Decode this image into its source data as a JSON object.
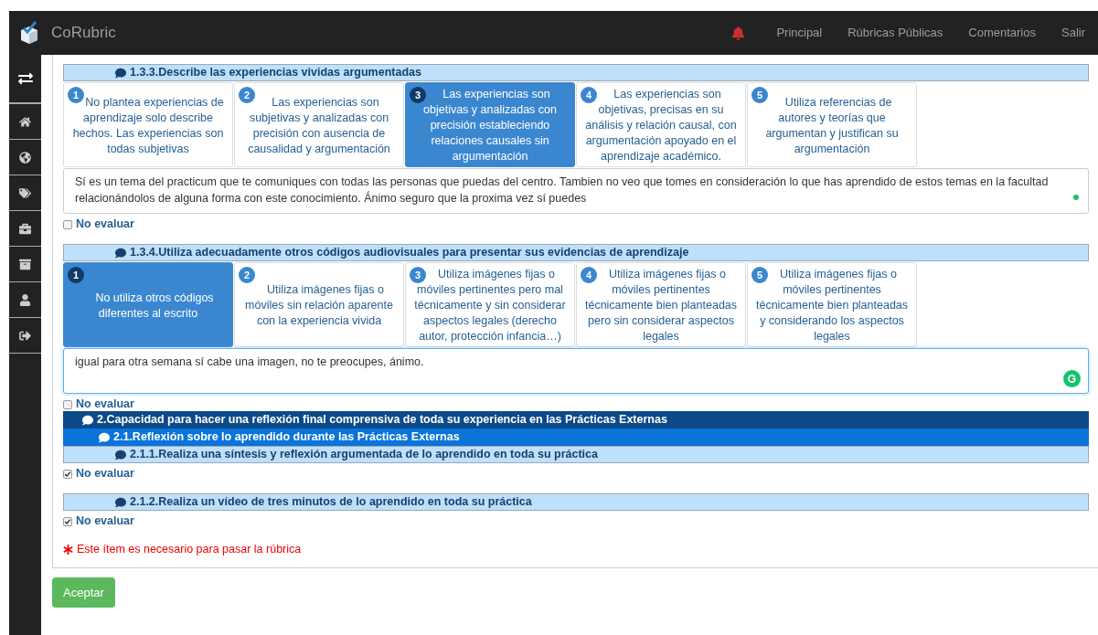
{
  "navbar": {
    "brand": "CoRubric",
    "links": [
      "Principal",
      "Rúbricas Públicas",
      "Comentarios",
      "Salir"
    ]
  },
  "sections": [
    {
      "kind": "indicator",
      "title": "1.3.3.Describe las experiencias vividas argumentadas",
      "options": [
        {
          "number": "1",
          "text": "No plantea experiencias de aprendizaje solo describe hechos. Las experiencias son todas subjetivas",
          "selected": false
        },
        {
          "number": "2",
          "text": "Las experiencias son subjetivas y analizadas con precisión con ausencia de causalidad y argumentación",
          "selected": false
        },
        {
          "number": "3",
          "text": "Las experiencias son objetivas y analizadas con precisión estableciendo relaciones causales sin argumentación",
          "selected": true
        },
        {
          "number": "4",
          "text": "Las experiencias son objetivas, precisas en su análisis y relación causal, con argumentación apoyado en el aprendizaje académico.",
          "selected": false
        },
        {
          "number": "5",
          "text": "Utiliza referencias de autores y teorías que argumentan y justifican su argumentación",
          "selected": false
        }
      ],
      "comment": {
        "value": "Sí es un tema del practicum que te comuniques con todas las personas que puedas del centro. Tambien no veo que tomes en consideración lo que has aprendido de estos temas en la facultad relacionándolos de alguna forma con este conocimiento. Ánimo seguro que la proxima vez sí puedes",
        "focused": false
      },
      "no_evaluar": {
        "label": "No evaluar",
        "checked": false
      }
    },
    {
      "kind": "indicator",
      "title": "1.3.4.Utiliza adecuadamente otros códigos audiovisuales para presentar sus evidencias de aprendizaje",
      "options": [
        {
          "number": "1",
          "text": "No utiliza otros códigos diferentes al escrito",
          "selected": true
        },
        {
          "number": "2",
          "text": "Utiliza imágenes fijas o móviles sin relación aparente con la experiencia vivida",
          "selected": false
        },
        {
          "number": "3",
          "text": "Utiliza imágenes fijas o móviles pertinentes pero mal técnicamente y sin considerar aspectos legales (derecho autor, protección infancia…)",
          "selected": false
        },
        {
          "number": "4",
          "text": "Utiliza imágenes fijas o móviles pertinentes técnicamente bien planteadas pero sin considerar aspectos legales",
          "selected": false
        },
        {
          "number": "5",
          "text": "Utiliza imágenes fijas o móviles pertinentes técnicamente bien planteadas y considerando los aspectos legales",
          "selected": false
        }
      ],
      "comment": {
        "value": "igual para otra semana sí cabe una imagen, no te preocupes, ánimo.",
        "focused": true
      },
      "no_evaluar": {
        "label": "No evaluar",
        "checked": false
      }
    },
    {
      "kind": "criterion",
      "title": "2.Capacidad para hacer una reflexión final comprensiva de toda su experiencia en las Prácticas Externas"
    },
    {
      "kind": "subcriterion",
      "title": "2.1.Reflexión sobre lo aprendido durante las Prácticas Externas"
    },
    {
      "kind": "indicator",
      "title": "2.1.1.Realiza una síntesis y reflexión argumentada de lo aprendido en toda su práctica",
      "no_evaluar": {
        "label": "No evaluar",
        "checked": true
      }
    },
    {
      "kind": "indicator",
      "title": "2.1.2.Realiza un vídeo de tres minutos de lo aprendido en toda su práctica",
      "no_evaluar": {
        "label": "No evaluar",
        "checked": true
      }
    }
  ],
  "required_note": "Este ítem es necesario para pasar la rúbrica",
  "submit": "Aceptar"
}
